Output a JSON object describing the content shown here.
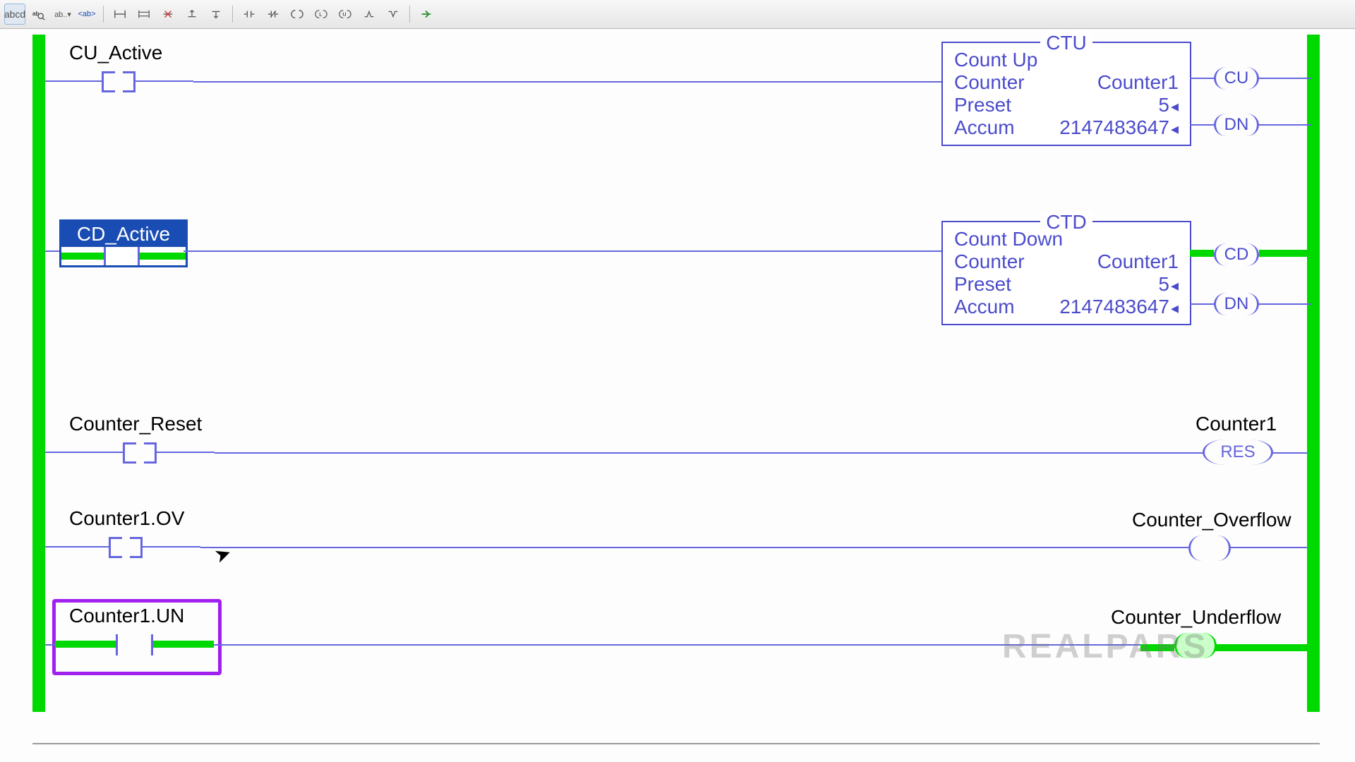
{
  "toolbar": {
    "buttons": [
      "abcd",
      "ab-search",
      "ab-drop",
      "tag",
      "sep",
      "rung",
      "branch",
      "del-rung",
      "ins-before",
      "ins-after",
      "sep",
      "xic",
      "xio",
      "ote",
      "otl",
      "otu",
      "ons",
      "osr",
      "sep",
      "run"
    ]
  },
  "rails": {
    "color_on": "#00d900"
  },
  "rung1": {
    "contact_tag": "CU_Active",
    "block": {
      "type": "CTU",
      "title": "Count Up",
      "counter_label": "Counter",
      "counter_value": "Counter1",
      "preset_label": "Preset",
      "preset_value": "5",
      "accum_label": "Accum",
      "accum_value": "2147483647"
    },
    "pins": {
      "cu": "CU",
      "dn": "DN"
    }
  },
  "rung2": {
    "contact_tag": "CD_Active",
    "contact_state": "on",
    "block": {
      "type": "CTD",
      "title": "Count Down",
      "counter_label": "Counter",
      "counter_value": "Counter1",
      "preset_label": "Preset",
      "preset_value": "5",
      "accum_label": "Accum",
      "accum_value": "2147483647"
    },
    "pins": {
      "cd": "CD",
      "dn": "DN"
    },
    "cd_state": "on"
  },
  "rung3": {
    "contact_tag": "Counter_Reset",
    "coil_tag": "Counter1",
    "coil_text": "RES"
  },
  "rung4": {
    "contact_tag": "Counter1.OV",
    "coil_tag": "Counter_Overflow"
  },
  "rung5": {
    "contact_tag": "Counter1.UN",
    "contact_state": "on",
    "coil_tag": "Counter_Underflow",
    "coil_state": "on"
  },
  "watermark": "REALPARS",
  "chart_data": {
    "type": "table",
    "description": "PLC ladder-logic rungs reproduced in the editor view",
    "rungs": [
      {
        "index": 1,
        "input": {
          "tag": "CU_Active",
          "type": "XIC",
          "state": "off"
        },
        "output": {
          "instruction": "CTU",
          "counter": "Counter1",
          "preset": 5,
          "accum": 2147483647,
          "pins": [
            {
              "name": "CU",
              "state": "off"
            },
            {
              "name": "DN",
              "state": "off"
            }
          ]
        }
      },
      {
        "index": 2,
        "input": {
          "tag": "CD_Active",
          "type": "XIC",
          "state": "on"
        },
        "output": {
          "instruction": "CTD",
          "counter": "Counter1",
          "preset": 5,
          "accum": 2147483647,
          "pins": [
            {
              "name": "CD",
              "state": "on"
            },
            {
              "name": "DN",
              "state": "off"
            }
          ]
        }
      },
      {
        "index": 3,
        "input": {
          "tag": "Counter_Reset",
          "type": "XIC",
          "state": "off"
        },
        "output": {
          "instruction": "RES",
          "tag": "Counter1",
          "state": "off"
        }
      },
      {
        "index": 4,
        "input": {
          "tag": "Counter1.OV",
          "type": "XIC",
          "state": "off"
        },
        "output": {
          "instruction": "OTE",
          "tag": "Counter_Overflow",
          "state": "off"
        }
      },
      {
        "index": 5,
        "input": {
          "tag": "Counter1.UN",
          "type": "XIC",
          "state": "on"
        },
        "output": {
          "instruction": "OTE",
          "tag": "Counter_Underflow",
          "state": "on"
        }
      }
    ]
  }
}
